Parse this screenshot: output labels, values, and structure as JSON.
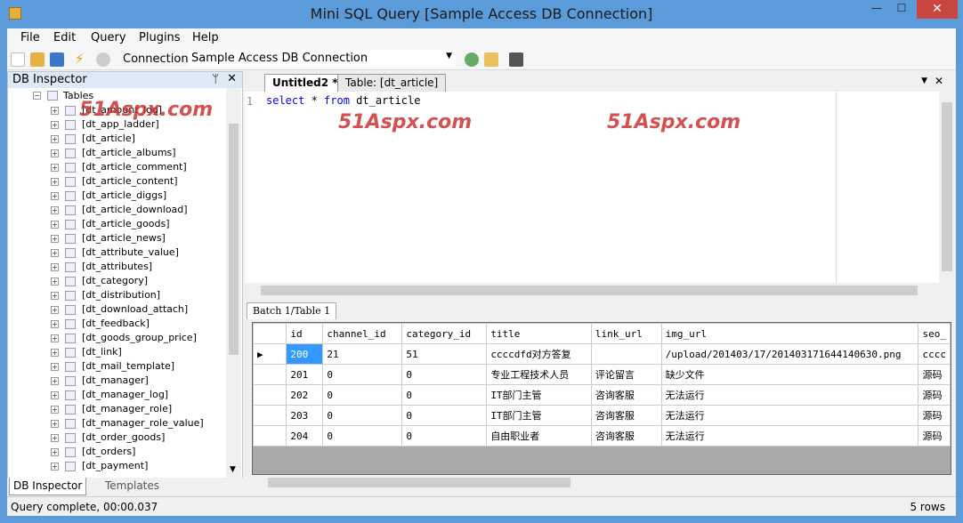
{
  "window": {
    "title": "Mini SQL Query [Sample Access DB Connection]",
    "minimize": "—",
    "maximize": "☐",
    "close": "✕"
  },
  "menu": [
    "File",
    "Edit",
    "Query",
    "Plugins",
    "Help"
  ],
  "toolbar": {
    "connection_label": "Connection:",
    "connection_value": "Sample Access DB Connection"
  },
  "db_inspector": {
    "title": "DB Inspector",
    "root": "Tables",
    "tables": [
      "[dt_amount_log]",
      "[dt_app_ladder]",
      "[dt_article]",
      "[dt_article_albums]",
      "[dt_article_comment]",
      "[dt_article_content]",
      "[dt_article_diggs]",
      "[dt_article_download]",
      "[dt_article_goods]",
      "[dt_article_news]",
      "[dt_attribute_value]",
      "[dt_attributes]",
      "[dt_category]",
      "[dt_distribution]",
      "[dt_download_attach]",
      "[dt_feedback]",
      "[dt_goods_group_price]",
      "[dt_link]",
      "[dt_mail_template]",
      "[dt_manager]",
      "[dt_manager_log]",
      "[dt_manager_role]",
      "[dt_manager_role_value]",
      "[dt_order_goods]",
      "[dt_orders]",
      "[dt_payment]"
    ]
  },
  "bottom_tabs": [
    "DB Inspector",
    "Templates"
  ],
  "doc_tabs": [
    "Untitled2 *",
    "Table: [dt_article]"
  ],
  "editor": {
    "line_number": "1",
    "kw1": "select",
    "mid": " * ",
    "kw2": "from",
    "rest": " dt_article"
  },
  "watermark": "51Aspx.com",
  "result_tab": "Batch 1/Table 1",
  "grid": {
    "columns": [
      "id",
      "channel_id",
      "category_id",
      "title",
      "link_url",
      "img_url",
      "seo_"
    ],
    "rows": [
      [
        "200",
        "21",
        "51",
        "ccccdfd对方答复",
        "",
        "/upload/201403/17/201403171644140630.png",
        "cccc"
      ],
      [
        "201",
        "0",
        "0",
        "专业工程技术人员",
        "评论留言",
        "缺少文件",
        "源码"
      ],
      [
        "202",
        "0",
        "0",
        "IT部门主管",
        "咨询客服",
        "无法运行",
        "源码"
      ],
      [
        "203",
        "0",
        "0",
        "IT部门主管",
        "咨询客服",
        "无法运行",
        "源码"
      ],
      [
        "204",
        "0",
        "0",
        "自由职业者",
        "咨询客服",
        "无法运行",
        "源码"
      ]
    ]
  },
  "status": {
    "left": "Query complete, 00:00.037",
    "right": "5 rows"
  }
}
